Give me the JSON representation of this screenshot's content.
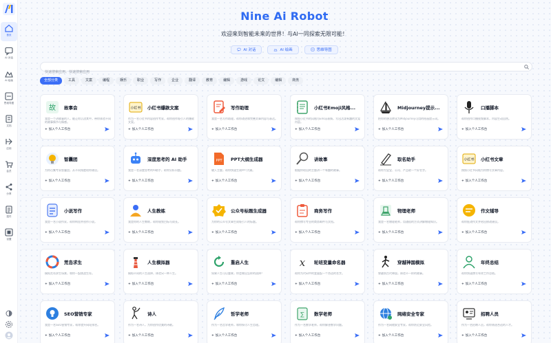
{
  "app": {
    "title": "Nine Ai Robot",
    "subtitle": "欢迎来到智能未来的世界！与AI一同探索无限可能！"
  },
  "colors": {
    "accent": "#3b6ef6"
  },
  "header_chips": [
    {
      "label": "AI 对话",
      "icon": "chat-icon"
    },
    {
      "label": "AI 绘画",
      "icon": "paint-icon"
    },
    {
      "label": "思维导图",
      "icon": "mindmap-icon"
    }
  ],
  "search": {
    "placeholder": "快速搜索应用、快速搜索应用",
    "value": ""
  },
  "categories": [
    "全部分类",
    "工具",
    "文案",
    "编程",
    "娱乐",
    "职业",
    "写作",
    "企业",
    "翻译",
    "教育",
    "编辑",
    "游戏",
    "论文",
    "编辑",
    "商务"
  ],
  "sidebar": {
    "items": [
      {
        "label": "首页",
        "icon": "home-icon"
      },
      {
        "label": "AI 对话",
        "icon": "chat-icon"
      },
      {
        "label": "AI 绘画",
        "icon": "paint-icon"
      },
      {
        "label": "思维导图",
        "icon": "mindmap-icon"
      },
      {
        "label": "文档",
        "icon": "doc-icon"
      },
      {
        "label": "应用",
        "icon": "app-icon"
      },
      {
        "label": "会员",
        "icon": "cart-icon"
      },
      {
        "label": "分享",
        "icon": "share-icon"
      },
      {
        "label": "插件",
        "icon": "plugin-icon"
      },
      {
        "label": "设置",
        "icon": "settings-icon"
      }
    ]
  },
  "card_action": "加入个人工作台",
  "cards": [
    {
      "title": "故事会",
      "desc": "我是一个讲故事的人，能让你沉浸其中，带你体验不同的故事情节与情感。",
      "icon": "book-icon",
      "color": "#2fa36b"
    },
    {
      "title": "小红书爆款文案",
      "desc": "作为一名小红书内容创作专家，帮你创作吸引人的爆款文案。",
      "icon": "xiaohongshu-icon",
      "color": "#e0a800"
    },
    {
      "title": "写作助理",
      "desc": "我是一名写作助理，帮你改进和完善文章内容与表达。",
      "icon": "edit-doc-icon",
      "color": "#ef5a3c"
    },
    {
      "title": "小红书Emoji风格...",
      "desc": "按照小红书的风格与Emoji表情，写出活泼有趣的文案内容。",
      "icon": "notebook-icon",
      "color": "#3fa46b"
    },
    {
      "title": "Midjourney提示...",
      "desc": "把你的想法转化为Midjourney可用的绘画提示词。",
      "icon": "ship-icon",
      "color": "#2b2b2b"
    },
    {
      "title": "口播脚本",
      "desc": "帮你创作口播视频脚本，内容生动自然。",
      "icon": "microphone-icon",
      "color": "#222"
    },
    {
      "title": "智囊团",
      "desc": "为你召集专家智囊团，从不同角度给你建议。",
      "icon": "brain-icon",
      "color": "#f5b400"
    },
    {
      "title": "深度思考的 AI 助手",
      "desc": "我是一名深度思考的AI助手，帮你分析问题。",
      "icon": "robot-icon",
      "color": "#3b82f6"
    },
    {
      "title": "PPT大纲生成器",
      "desc": "输入主题，帮你快速生成PPT大纲。",
      "icon": "ppt-icon",
      "color": "#f26a2a"
    },
    {
      "title": "讲故事",
      "desc": "根据你给出的主题讲一个有趣的故事。",
      "icon": "search-icon",
      "color": "#555"
    },
    {
      "title": "取名助手",
      "desc": "帮你为宝宝、公司、产品取一个好名字。",
      "icon": "pen-icon",
      "color": "#333"
    },
    {
      "title": "小红书文章",
      "desc": "按照小红书风格为你撰写文章内容。",
      "icon": "xiaohongshu-icon",
      "color": "#e0a800"
    },
    {
      "title": "小说写作",
      "desc": "我是一名小说作家，帮你构思并创作小说。",
      "icon": "document-icon",
      "color": "#4f7cf0"
    },
    {
      "title": "人生教练",
      "desc": "我是你的人生教练，帮你规划目标与成长。",
      "icon": "coach-icon",
      "color": "#f5a623"
    },
    {
      "title": "公众号标题生成器",
      "desc": "为你的公众号文章生成吸引人的标题。",
      "icon": "badge-icon",
      "color": "#f5b400"
    },
    {
      "title": "商务写作",
      "desc": "帮你撰写专业的商务邮件与文档。",
      "icon": "clipboard-icon",
      "color": "#ef5a3c"
    },
    {
      "title": "物理老师",
      "desc": "我是一名物理老师，用通俗的方式讲解物理知识。",
      "icon": "physics-icon",
      "color": "#3fa46b"
    },
    {
      "title": "作文辅导",
      "desc": "帮你批改作文并给出修改建议。",
      "icon": "essay-icon",
      "color": "#f5b400"
    },
    {
      "title": "荒岛求生",
      "desc": "模拟荒岛求生场景，和你一起挑战生存。",
      "icon": "lifebuoy-icon",
      "color": "#2d7fe0"
    },
    {
      "title": "人生模拟器",
      "desc": "模拟不同的人生选择，体验另一种人生。",
      "icon": "lighthouse-icon",
      "color": "#e8573c"
    },
    {
      "title": "重启人生",
      "desc": "如果人生可以重来，你会做出怎样的选择？",
      "icon": "restart-icon",
      "color": "#2fa36b"
    },
    {
      "title": "轮班变量命名器",
      "desc": "帮你为代码中的变量起一个合适的名字。",
      "icon": "variable-icon",
      "color": "#333"
    },
    {
      "title": "穿越神国模拟",
      "desc": "穿越到古代神国，体验不一样的故事。",
      "icon": "time-travel-icon",
      "color": "#222"
    },
    {
      "title": "年终总结",
      "desc": "帮你快速撰写年终工作总结。",
      "icon": "person-icon",
      "color": "#2fa36b"
    },
    {
      "title": "SEO营销专家",
      "desc": "我是一名SEO营销专家，帮你提升网站排名。",
      "icon": "bulb-icon",
      "color": "#2d7fe0"
    },
    {
      "title": "诗人",
      "desc": "作为一名诗人，为你创作优美的诗歌。",
      "icon": "poet-icon",
      "color": "#222"
    },
    {
      "title": "哲学老师",
      "desc": "作为一名哲学老师，和你探讨人生哲理。",
      "icon": "feather-icon",
      "color": "#2d7fe0"
    },
    {
      "title": "数学老师",
      "desc": "作为一名数学老师，帮你解答数学问题。",
      "icon": "math-icon",
      "color": "#3fa46b"
    },
    {
      "title": "网络安全专家",
      "desc": "作为一名网络安全专家，帮你防范安全风险。",
      "icon": "globe-icon",
      "color": "#2d7fe0"
    },
    {
      "title": "招聘人员",
      "desc": "作为一名招聘人员，帮你筛选合适的人才。",
      "icon": "recruit-icon",
      "color": "#333"
    }
  ]
}
